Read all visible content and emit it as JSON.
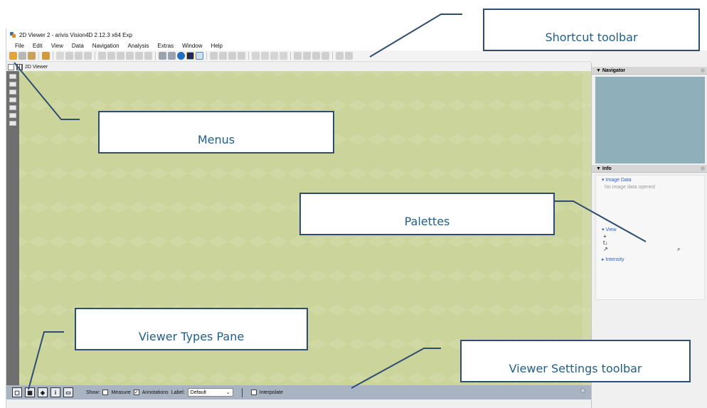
{
  "window": {
    "title": "2D Viewer 2 - arivis Vision4D 2.12.3 x64 Exp",
    "icon": "arivis-app-icon"
  },
  "menubar": {
    "items": [
      {
        "label": "File"
      },
      {
        "label": "Edit"
      },
      {
        "label": "View"
      },
      {
        "label": "Data"
      },
      {
        "label": "Navigation"
      },
      {
        "label": "Analysis"
      },
      {
        "label": "Extras"
      },
      {
        "label": "Window"
      },
      {
        "label": "Help"
      }
    ]
  },
  "shortcut_toolbar": {
    "icons": [
      "open-icon",
      "save-icon",
      "import-icon",
      "export-icon",
      "pointer-icon",
      "pan-icon",
      "zoom-icon",
      "rotate-icon",
      "measure-icon",
      "tag-icon",
      "grid-icon",
      "table-icon",
      "pen-icon",
      "brush-icon",
      "flask-icon",
      "sheet-icon",
      "info-icon",
      "histogram-icon",
      "display-icon",
      "layer-icon",
      "layer-add-icon",
      "layer-copy-icon",
      "layer-remove-icon",
      "first-frame-icon",
      "prev-frame-icon",
      "play-icon",
      "last-frame-icon",
      "zoom-in-icon",
      "zoom-out-icon",
      "fit-icon",
      "fullscreen-icon",
      "snap-icon",
      "snap-add-icon"
    ]
  },
  "viewer_tab": {
    "label": "2D Viewer"
  },
  "right_panel": {
    "navigator": {
      "header": "Navigator"
    },
    "info": {
      "header": "Info",
      "image_data_label": "Image Data",
      "image_data_empty": "No image data opened",
      "view_label": "View",
      "view_glyphs": [
        "+",
        "t↓",
        "↗",
        "⌕"
      ],
      "intensity_label": "Intensity"
    }
  },
  "viewer_settings": {
    "viewer_types": [
      "single-view-icon",
      "split-view-icon",
      "3d-cube-icon",
      "info-i-icon",
      "monitor-icon"
    ],
    "show_label": "Show:",
    "measure_label": "Measure",
    "measure_checked": false,
    "annotations_label": "Annotations",
    "annotations_checked": true,
    "label_label": "Label:",
    "label_value": "Default",
    "interpolate_label": "Interpolate",
    "interpolate_checked": false
  },
  "callouts": {
    "shortcut_toolbar": "Shortcut toolbar",
    "menus": "Menus",
    "palettes": "Palettes",
    "viewer_types_pane": "Viewer Types Pane",
    "viewer_settings_toolbar": "Viewer Settings toolbar"
  },
  "colors": {
    "canvas": "#cbd49a",
    "navigator": "#8fb0bb",
    "settings_bar": "#a9b4c3",
    "callout_border": "#2f4d70",
    "callout_text": "#1f5f8b",
    "link_blue": "#2c63c8"
  }
}
